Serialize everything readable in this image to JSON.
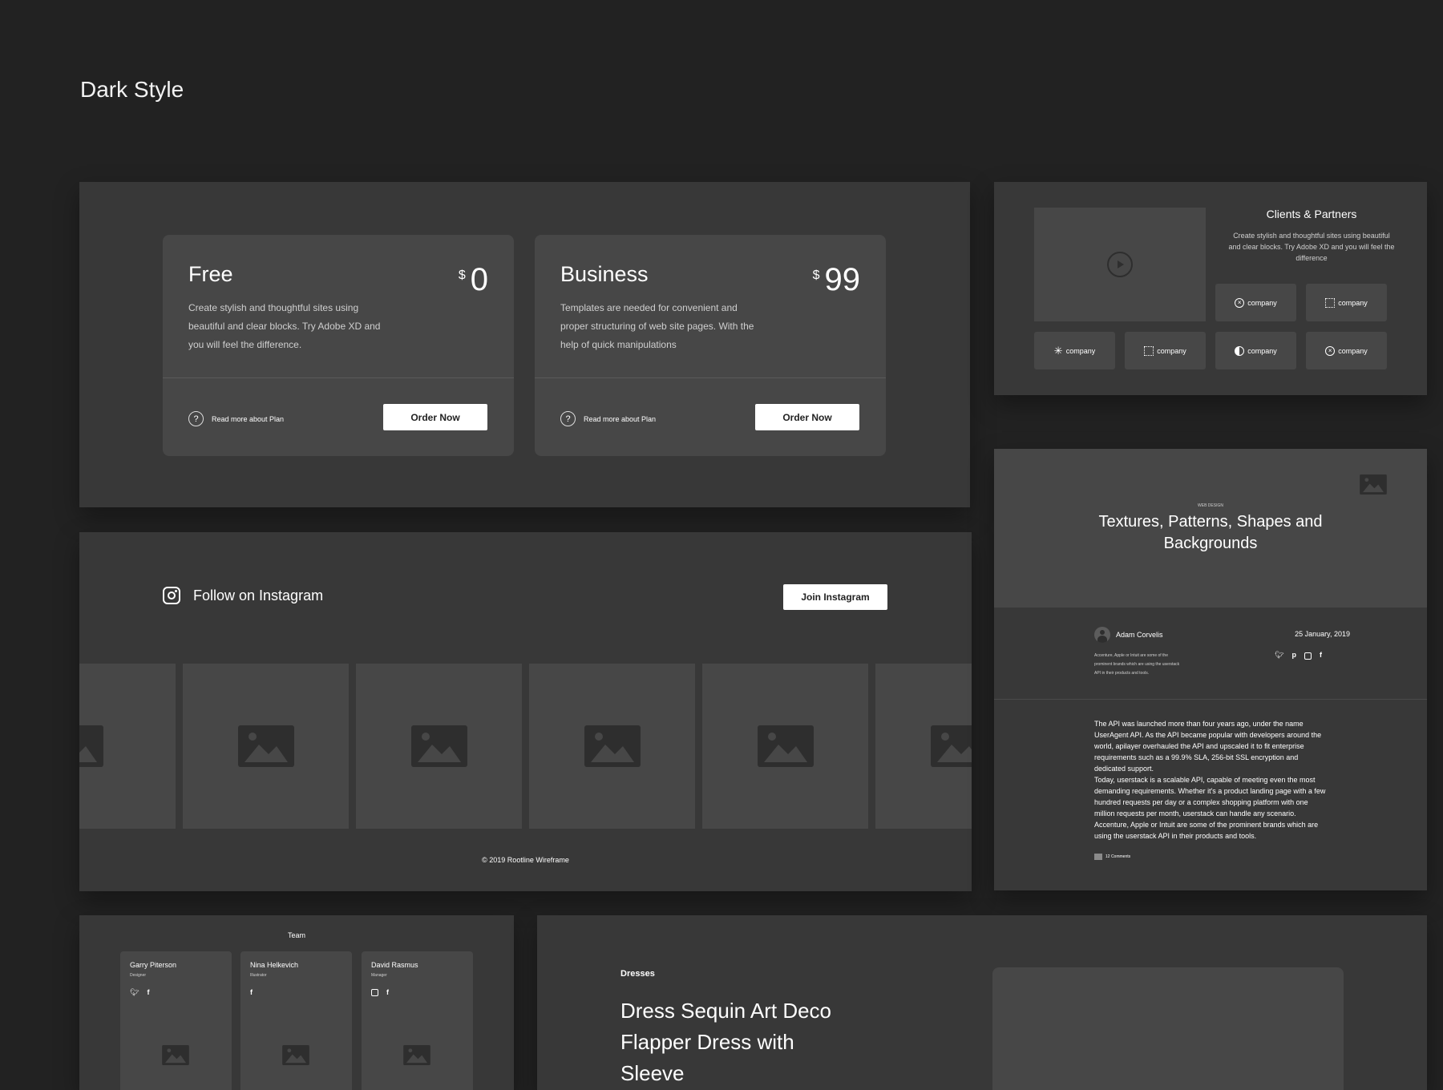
{
  "page": {
    "title": "Dark Style"
  },
  "pricing": {
    "plans": [
      {
        "name": "Free",
        "currency": "$",
        "price": "0",
        "description": "Create stylish and thoughtful sites using beautiful and clear blocks. Try Adobe XD and you will feel the difference.",
        "read_more": "Read more about Plan",
        "order_label": "Order Now"
      },
      {
        "name": "Business",
        "currency": "$",
        "price": "99",
        "description": "Templates are needed for convenient and proper structuring of web site pages. With the help of quick manipulations",
        "read_more": "Read more about Plan",
        "order_label": "Order Now"
      }
    ]
  },
  "clients": {
    "title": "Clients & Partners",
    "description": "Create stylish and thoughtful sites using beautiful and clear blocks. Try Adobe XD and you will feel the difference",
    "logos": [
      "company",
      "company",
      "company",
      "company",
      "company",
      "company"
    ]
  },
  "instagram": {
    "title": "Follow on Instagram",
    "join_label": "Join Instagram",
    "footer": "© 2019 Rootline Wireframe"
  },
  "article": {
    "category": "WEB DESIGN",
    "title": "Textures, Patterns, Shapes and Backgrounds",
    "author": "Adam Corvelis",
    "date": "25 January, 2019",
    "author_bio": "Accenture, Apple or Intuit are some of the prominent brands which are using the userstack API in their products and tools.",
    "paragraph1": "The API was launched more than four years ago, under the name UserAgent API. As the API became popular with developers around the world, apilayer overhauled the API and upscaled it to fit enterprise requirements such as a 99.9% SLA, 256-bit SSL encryption and dedicated support.",
    "paragraph2": "Today, userstack is a scalable API, capable of meeting even the most demanding requirements. Whether it's a product landing page with a few hundred requests per day or a complex shopping platform with one million requests per month, userstack can handle any scenario.  Accenture, Apple or Intuit are some of the prominent brands which are using the userstack API in their products and tools.",
    "comments": "12 Comments"
  },
  "team": {
    "title": "Team",
    "members": [
      {
        "name": "Garry Piterson",
        "role": "Designer"
      },
      {
        "name": "Nina Helkevich",
        "role": "Illustrator"
      },
      {
        "name": "David Rasmus",
        "role": "Manager"
      }
    ]
  },
  "product": {
    "category": "Dresses",
    "title": "Dress Sequin Art Deco Flapper Dress with Sleeve"
  }
}
